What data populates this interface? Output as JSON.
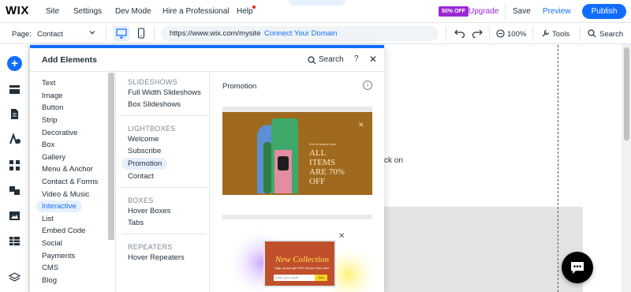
{
  "topbar": {
    "logo": "WIX",
    "nav": [
      "Site",
      "Settings",
      "Dev Mode",
      "Hire a Professional",
      "Help"
    ],
    "badge": "50% OFF",
    "upgrade": "Upgrade",
    "save": "Save",
    "preview": "Preview",
    "publish": "Publish"
  },
  "subbar": {
    "page_label": "Page:",
    "page_value": "Contact",
    "url": "https://www.wix.com/mysite",
    "connect": "Connect Your Domain",
    "zoom": "100%",
    "tools": "Tools",
    "search": "Search"
  },
  "panel": {
    "title": "Add Elements",
    "search": "Search",
    "help": "?",
    "close": "✕",
    "categories": [
      "Text",
      "Image",
      "Button",
      "Strip",
      "Decorative",
      "Box",
      "Gallery",
      "Menu & Anchor",
      "Contact & Forms",
      "Video & Music",
      "Interactive",
      "List",
      "Embed Code",
      "Social",
      "Payments",
      "CMS",
      "Blog"
    ],
    "selected_category": "Interactive",
    "sections": [
      {
        "title": "SLIDESHOWS",
        "items": [
          "Full Width Slideshows",
          "Box Slideshows"
        ]
      },
      {
        "title": "LIGHTBOXES",
        "items": [
          "Welcome",
          "Subscribe",
          "Promotion",
          "Contact"
        ]
      },
      {
        "title": "BOXES",
        "items": [
          "Hover Boxes",
          "Tabs"
        ]
      },
      {
        "title": "REPEATERS",
        "items": [
          "Hover Repeaters"
        ]
      }
    ],
    "selected_item": "Promotion",
    "preview_title": "Promotion",
    "info": "i",
    "card1": {
      "small": "End of season sale",
      "text": "ALL ITEMS ARE 70% OFF",
      "line1": "ALL",
      "line2": "ITEMS",
      "line3": "ARE 70%",
      "line4": "OFF",
      "close": "✕"
    },
    "card2": {
      "title": "New Collection",
      "subtitle": "Sign up and get 30% off your first order",
      "input": "Enter your email",
      "button": "Join",
      "close": "✕"
    }
  },
  "canvas": {
    "text_fragment": "ck on"
  },
  "colors": {
    "accent": "#116dff",
    "upgrade": "#9a27d5",
    "promo_bg": "#a06a1e"
  }
}
